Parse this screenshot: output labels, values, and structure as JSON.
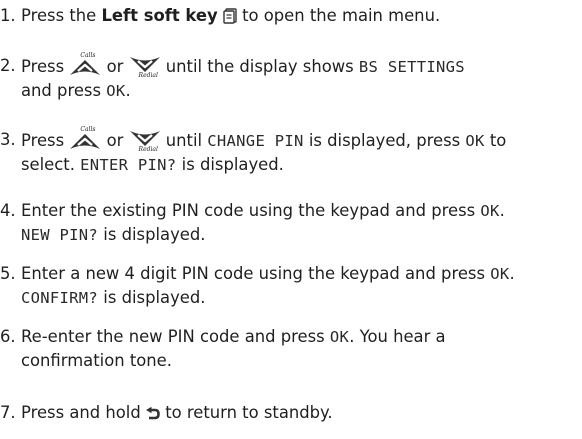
{
  "step1": {
    "num": "1.",
    "a": "Press the ",
    "b": "Left soft key",
    "c": " to open the main menu.",
    "icon": "menu-book-icon"
  },
  "step2": {
    "num": "2.",
    "a": "Press ",
    "calls": "Calls",
    "or": " or ",
    "redial": "Redial",
    "b": " until the display shows ",
    "lcd1": "BS SETTINGS",
    "c": "and press ",
    "lcd2": "OK",
    "d": "."
  },
  "step3": {
    "num": "3.",
    "a": "Press ",
    "calls": "Calls",
    "or": " or ",
    "redial": "Redial",
    "b": " until ",
    "lcd1": "CHANGE PIN",
    "c": " is displayed, press ",
    "lcd2": "OK",
    "d": " to",
    "e": "select. ",
    "lcd3": "ENTER PIN?",
    "f": " is displayed."
  },
  "step4": {
    "num": "4.",
    "a": "Enter the existing PIN code using the keypad and press ",
    "lcd1": "OK",
    "b": ".",
    "lcd2": "NEW PIN?",
    "c": " is displayed."
  },
  "step5": {
    "num": "5.",
    "a": "Enter a new 4 digit PIN code using the keypad and press ",
    "lcd1": "OK",
    "b": ".",
    "lcd2": "CONFIRM?",
    "c": " is displayed."
  },
  "step6": {
    "num": "6.",
    "a": "Re-enter the new PIN code and press ",
    "lcd1": "OK",
    "b": ". You hear a",
    "c": "confirmation tone."
  },
  "step7": {
    "num": "7.",
    "a": "Press and hold ",
    "b": " to return to standby.",
    "icon": "back-arrow-icon"
  },
  "colors": {
    "text": "#1f1f1f",
    "key": "#333333"
  }
}
